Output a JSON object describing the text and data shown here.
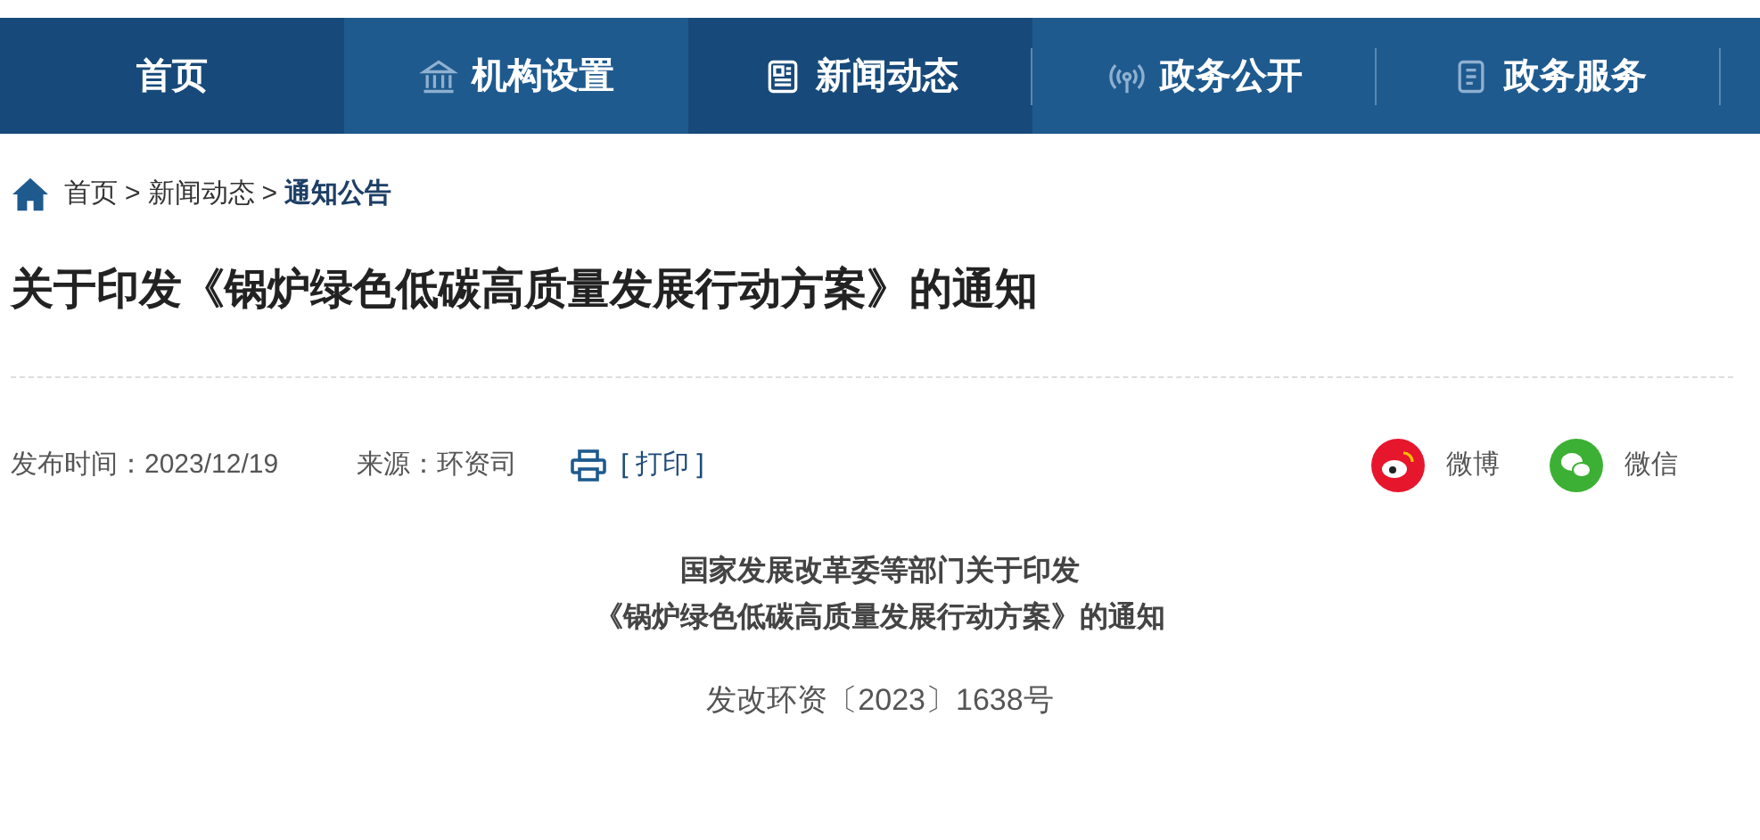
{
  "nav": [
    {
      "label": "首页",
      "selected": true
    },
    {
      "label": "机构设置",
      "selected": false
    },
    {
      "label": "新闻动态",
      "selected": true
    },
    {
      "label": "政务公开",
      "selected": false
    },
    {
      "label": "政务服务",
      "selected": false
    }
  ],
  "breadcrumb": [
    {
      "label": "首页",
      "current": false
    },
    {
      "label": "新闻动态",
      "current": false
    },
    {
      "label": "通知公告",
      "current": true
    }
  ],
  "breadcrumb_separator": ">",
  "title": "关于印发《锅炉绿色低碳高质量发展行动方案》的通知",
  "meta": {
    "date": "发布时间：2023/12/19",
    "source": "来源：环资司",
    "print": "[ 打印 ]"
  },
  "share": [
    {
      "label": "微博",
      "kind": "weibo",
      "color": "#e6162d"
    },
    {
      "label": "微信",
      "kind": "wechat",
      "color": "#3cb034"
    }
  ],
  "body": {
    "heading": [
      "国家发展改革委等部门关于印发",
      "《锅炉绿色低碳高质量发展行动方案》的通知"
    ],
    "doc_number": "发改环资〔2023〕1638号"
  }
}
